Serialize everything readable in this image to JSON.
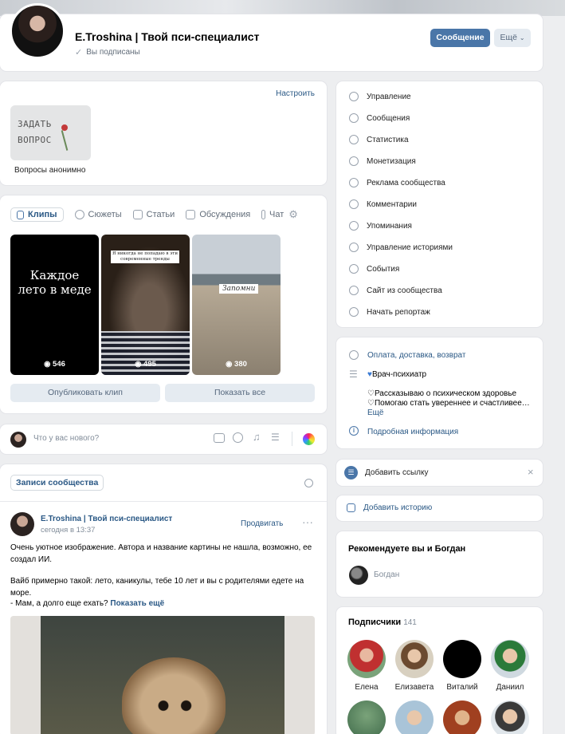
{
  "header": {
    "name": "E.Troshina | Твой пси-специалист",
    "subscribed": "Вы подписаны",
    "message_btn": "Сообщение",
    "more_btn": "Ещё"
  },
  "widget": {
    "configure": "Настроить",
    "card_text": "ЗАДАТЬ\nВОПРОС",
    "card_line1": "ЗАДАТЬ",
    "card_line2": "ВОПРОС",
    "caption": "Вопросы анонимно"
  },
  "tabs": {
    "clips": "Клипы",
    "stories": "Сюжеты",
    "articles": "Статьи",
    "discussions": "Обсуждения",
    "chat": "Чат"
  },
  "clips": [
    {
      "text": "Каждое лето в меде",
      "views": "546",
      "bg": "#000000"
    },
    {
      "text": "Я никогда не попадаю в эти современные тренды",
      "views": "495",
      "bg": "#2b2218"
    },
    {
      "text": "Запомни",
      "views": "380",
      "bg": "#a9a296"
    }
  ],
  "clip_buttons": {
    "publish": "Опубликовать клип",
    "show_all": "Показать все"
  },
  "composer": {
    "placeholder": "Что у вас нового?"
  },
  "wall": {
    "tab": "Записи сообщества",
    "post_author": "E.Troshina | Твой пси-специалист",
    "post_time": "сегодня в 13:37",
    "promote": "Продвигать",
    "text1": "Очень уютное изображение. Автора и название картины не нашла, возможно, ее создал ИИ.",
    "text2": "Вайб примерно такой: лето, каникулы, тебе 10 лет и вы с родителями едете на море.",
    "text3": "- Мам, а долго еще ехать?",
    "show_more": "Показать ещё"
  },
  "admin_menu": [
    "Управление",
    "Сообщения",
    "Статистика",
    "Монетизация",
    "Реклама сообщества",
    "Комментарии",
    "Упоминания",
    "Управление историями",
    "События",
    "Сайт из сообщества",
    "Начать репортаж"
  ],
  "info": {
    "delivery": "Оплата, доставка, возврат",
    "role": "Врач-психиатр",
    "line1": "Рассказываю о психическом здоровье",
    "line2": "Помогаю стать увереннее и счастливее…",
    "more": "Ещё",
    "details": "Подробная информация"
  },
  "add_link": "Добавить ссылку",
  "add_story": "Добавить историю",
  "recommend": {
    "title": "Рекомендуете вы и Богдан",
    "name": "Богдан"
  },
  "subscribers": {
    "title": "Подписчики",
    "count": "141",
    "names": [
      "Елена",
      "Елизавета",
      "Виталий",
      "Даниил"
    ]
  },
  "colors": {
    "accent": "#4a76a8",
    "link": "#2a5885",
    "bg": "#edeef0"
  }
}
